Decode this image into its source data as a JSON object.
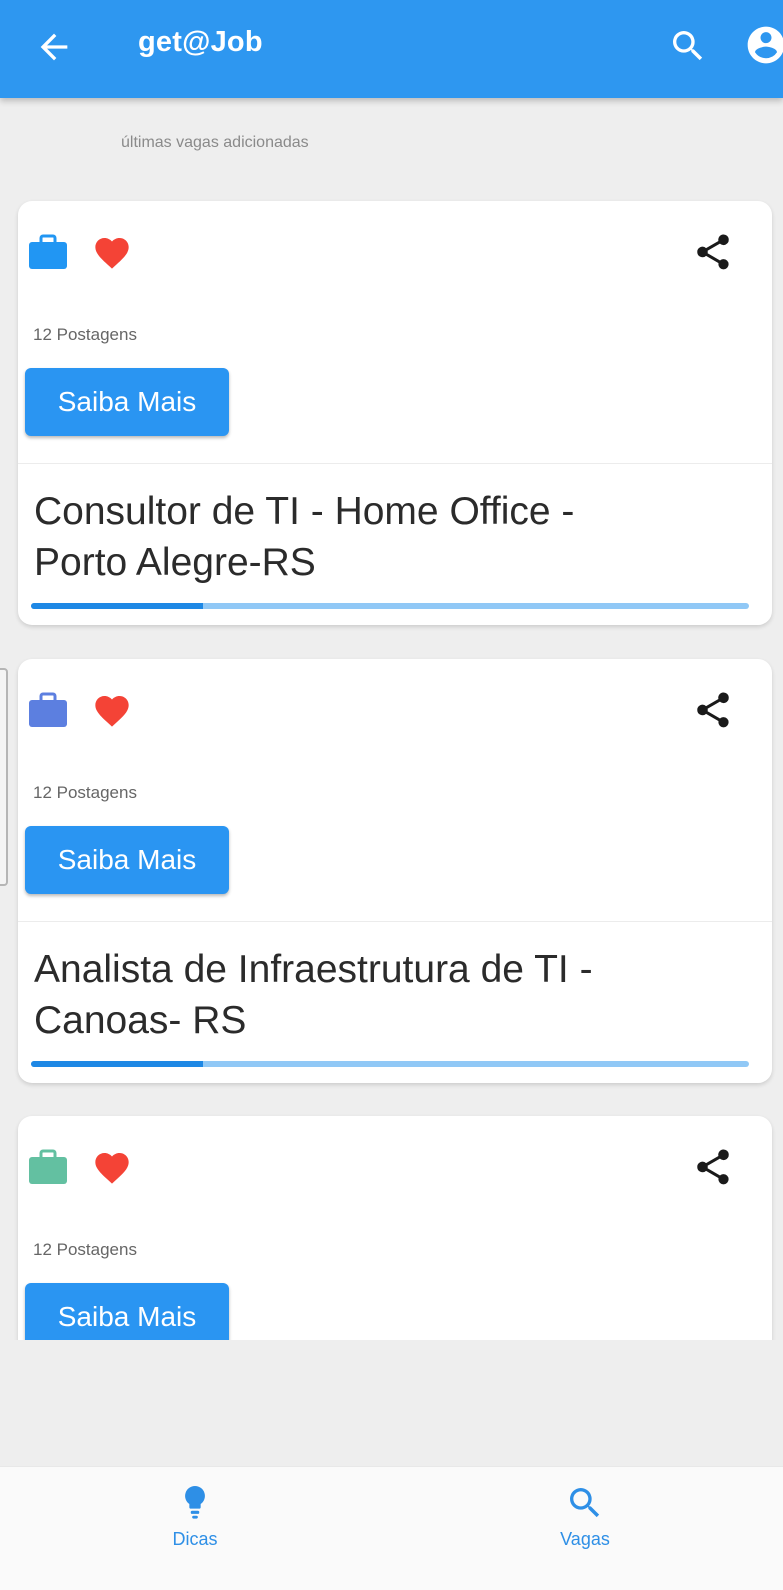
{
  "appbar": {
    "title": "get@Job",
    "icons": [
      "arrow-back-icon",
      "search-icon",
      "account-circle-icon"
    ]
  },
  "subtitle": "últimas vagas adicionadas",
  "colors": {
    "primary": "#2e97f0",
    "heart": "#f44336",
    "bag_colors": [
      "#2196f3",
      "#5c7fe0",
      "#63c0a1"
    ]
  },
  "jobs": [
    {
      "posts": "12 Postagens",
      "button": "Saiba Mais",
      "title_lines": [
        "Consultor de TI  - Home Office -",
        "Porto Alegre-RS"
      ],
      "progress": 0.24
    },
    {
      "posts": "12 Postagens",
      "button": "Saiba Mais",
      "title_lines": [
        "Analista de Infraestrutura de TI  -",
        "Canoas- RS"
      ],
      "progress": 0.24
    },
    {
      "posts": "12 Postagens",
      "button": "Saiba Mais"
    }
  ],
  "bottom_nav": {
    "items": [
      {
        "label": "Dicas",
        "icon": "lightbulb-icon"
      },
      {
        "label": "Vagas",
        "icon": "search-icon"
      }
    ]
  }
}
